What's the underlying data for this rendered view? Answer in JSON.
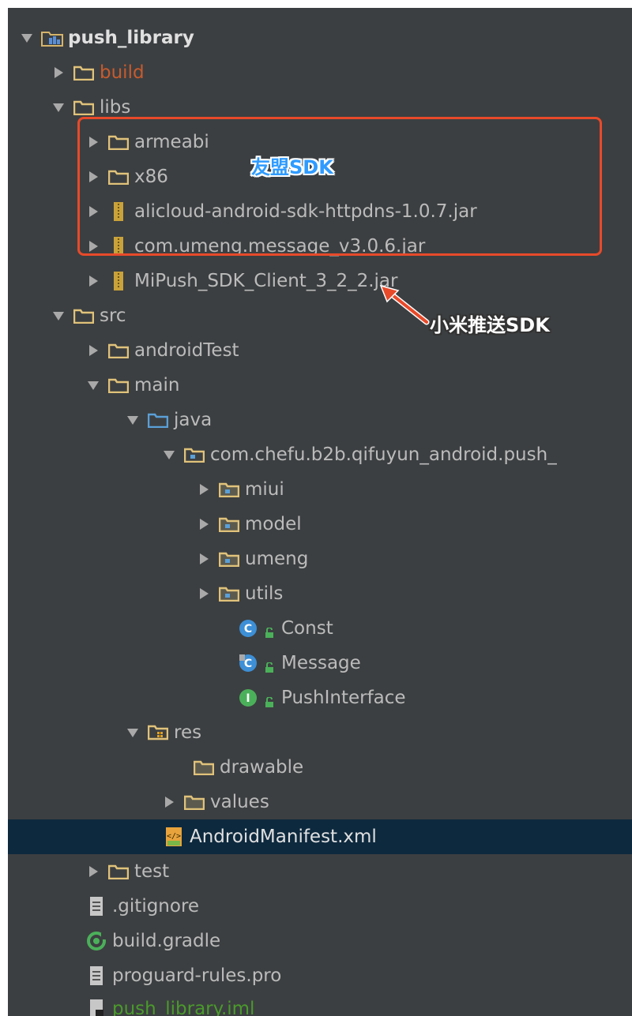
{
  "tree": {
    "push_library": "push_library",
    "build": "build",
    "libs": "libs",
    "armeabi": "armeabi",
    "x86": "x86",
    "alicloud_jar": "alicloud-android-sdk-httpdns-1.0.7.jar",
    "umeng_jar": "com.umeng.message_v3.0.6.jar",
    "mipush_jar": "MiPush_SDK_Client_3_2_2.jar",
    "src": "src",
    "androidTest": "androidTest",
    "main": "main",
    "java": "java",
    "package": "com.chefu.b2b.qifuyun_android.push_",
    "miui": "miui",
    "model": "model",
    "umeng": "umeng",
    "utils": "utils",
    "const": "Const",
    "message": "Message",
    "push_interface": "PushInterface",
    "res": "res",
    "drawable": "drawable",
    "values": "values",
    "manifest": "AndroidManifest.xml",
    "test": "test",
    "gitignore": ".gitignore",
    "build_gradle": "build.gradle",
    "proguard": "proguard-rules.pro",
    "iml": "push_library.iml"
  },
  "annotations": {
    "umeng_sdk": "友盟SDK",
    "xiaomi_sdk": "小米推送SDK"
  },
  "colors": {
    "panel_bg": "#3c3f41",
    "selection_bg": "#0d293e",
    "highlight_border": "#e84a2a",
    "annotation_blue": "#2f9bff",
    "excluded_red": "#c75b2e",
    "ignored_green": "#4a9a2c"
  }
}
